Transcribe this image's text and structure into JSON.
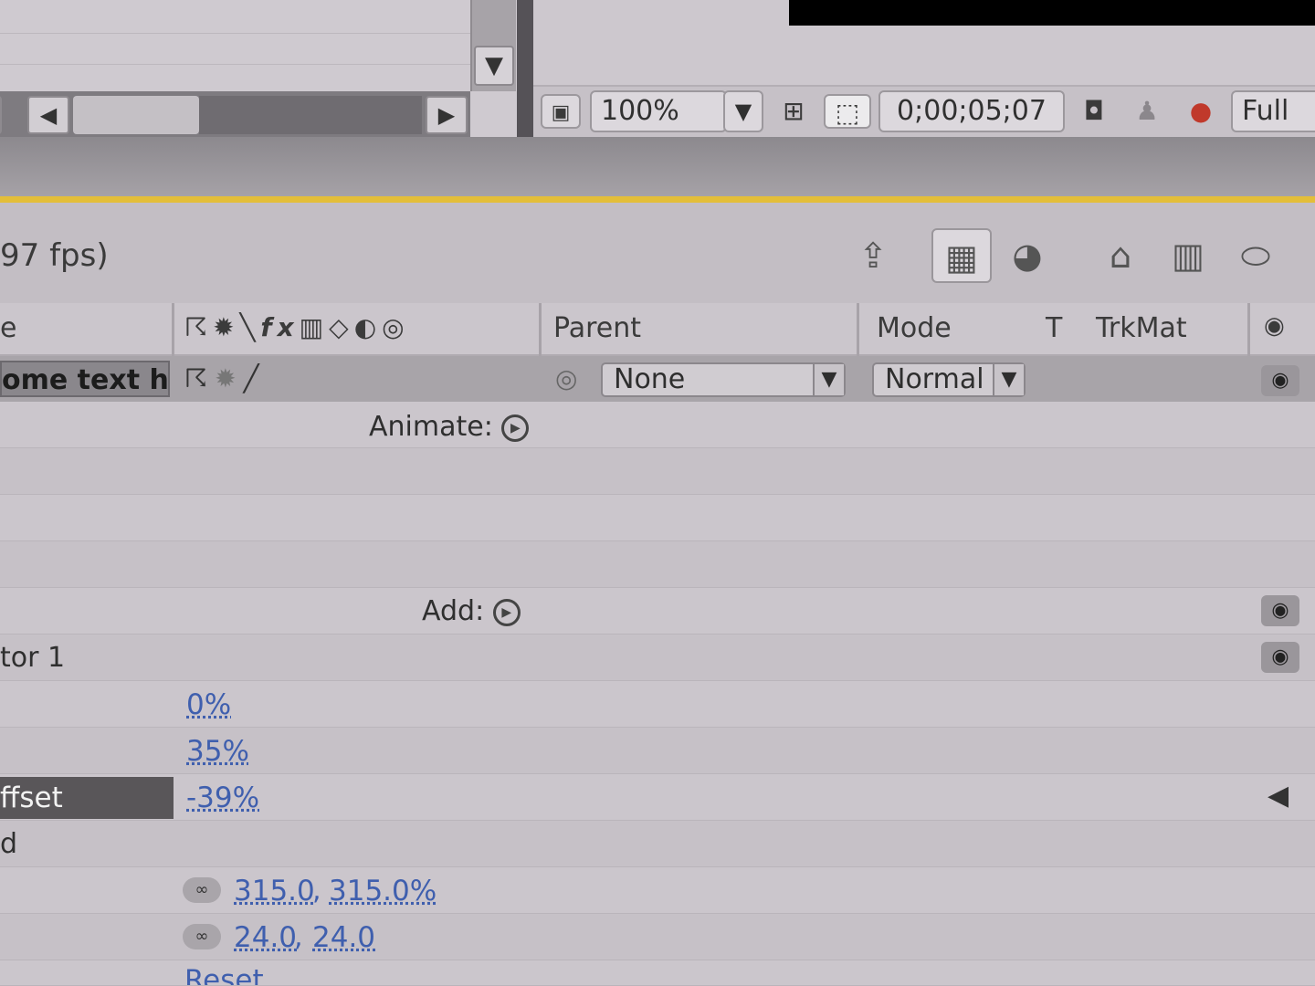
{
  "comp_toolbar": {
    "zoom": "100%",
    "timecode": "0;00;05;07",
    "resolution": "Full"
  },
  "timeline": {
    "fps_label": "97 fps)",
    "columns": {
      "name_fragment": "e",
      "parent": "Parent",
      "mode": "Mode",
      "t": "T",
      "trkmat": "TrkMat"
    },
    "layer": {
      "name": "ome text h",
      "parent_value": "None",
      "mode_value": "Normal"
    },
    "animate_label": "Animate:",
    "add_label": "Add:",
    "selector_label": "tor 1",
    "start_value": "0%",
    "end_value": "35%",
    "offset_label": "ffset",
    "offset_value": "-39%",
    "advanced_label": "d",
    "scale_value_a": "315.0",
    "scale_sep": ",",
    "scale_value_b": "315.0%",
    "size_value_a": "24.0",
    "size_sep": ",",
    "size_value_b": "24.0",
    "reset_label": "Reset"
  },
  "icons": {
    "comp_toolbar": [
      "monitor-icon",
      "zoom-dropdown-arrow-icon",
      "grid-icon",
      "region-of-interest-icon",
      "camera-icon",
      "person-icon",
      "rgb-channels-icon"
    ],
    "timeline_header": [
      "live-update-icon",
      "draft-3d-icon",
      "comp-flowchart-icon",
      "brainstorm-icon",
      "graph-editor-icon",
      "shy-layers-icon",
      "frame-blending-icon",
      "motion-blur-icon"
    ]
  }
}
